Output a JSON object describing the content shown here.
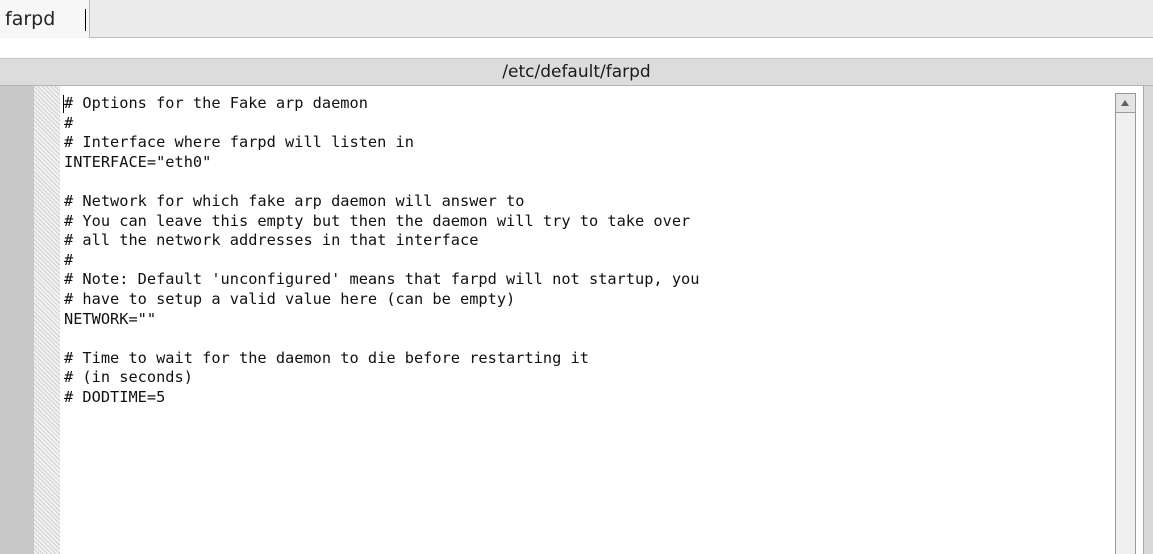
{
  "tabs": [
    {
      "label": "farpd"
    }
  ],
  "file": {
    "path": "/etc/default/farpd"
  },
  "editor": {
    "lines": [
      "# Options for the Fake arp daemon",
      "#",
      "# Interface where farpd will listen in",
      "INTERFACE=\"eth0\"",
      "",
      "# Network for which fake arp daemon will answer to",
      "# You can leave this empty but then the daemon will try to take over",
      "# all the network addresses in that interface",
      "#",
      "# Note: Default 'unconfigured' means that farpd will not startup, you",
      "# have to setup a valid value here (can be empty)",
      "NETWORK=\"\"",
      "",
      "# Time to wait for the daemon to die before restarting it",
      "# (in seconds)",
      "# DODTIME=5"
    ]
  },
  "icons": {
    "scroll_up": "triangle-up-icon"
  }
}
